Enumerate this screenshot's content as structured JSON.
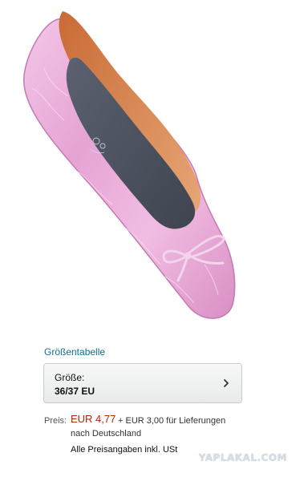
{
  "product": {
    "image_alt": "pink metallic ballerina flat shoe"
  },
  "size_chart": {
    "label": "Größentabelle"
  },
  "size_selector": {
    "label": "Größe:",
    "value": "36/37 EU"
  },
  "pricing": {
    "label": "Preis:",
    "price": "EUR 4,77",
    "shipping_line1": "+ EUR 3,00 für Lieferungen",
    "shipping_line2": "nach Deutschland",
    "vat_note": "Alle Preisangaben inkl. USt"
  },
  "watermark": {
    "text": "YAPLAKAL.COM"
  },
  "colors": {
    "link": "#0e6f9a",
    "price": "#b12704",
    "shoe_pink": "#e9a9d8",
    "insole": "#4a4f5a",
    "lining": "#d8834f"
  }
}
